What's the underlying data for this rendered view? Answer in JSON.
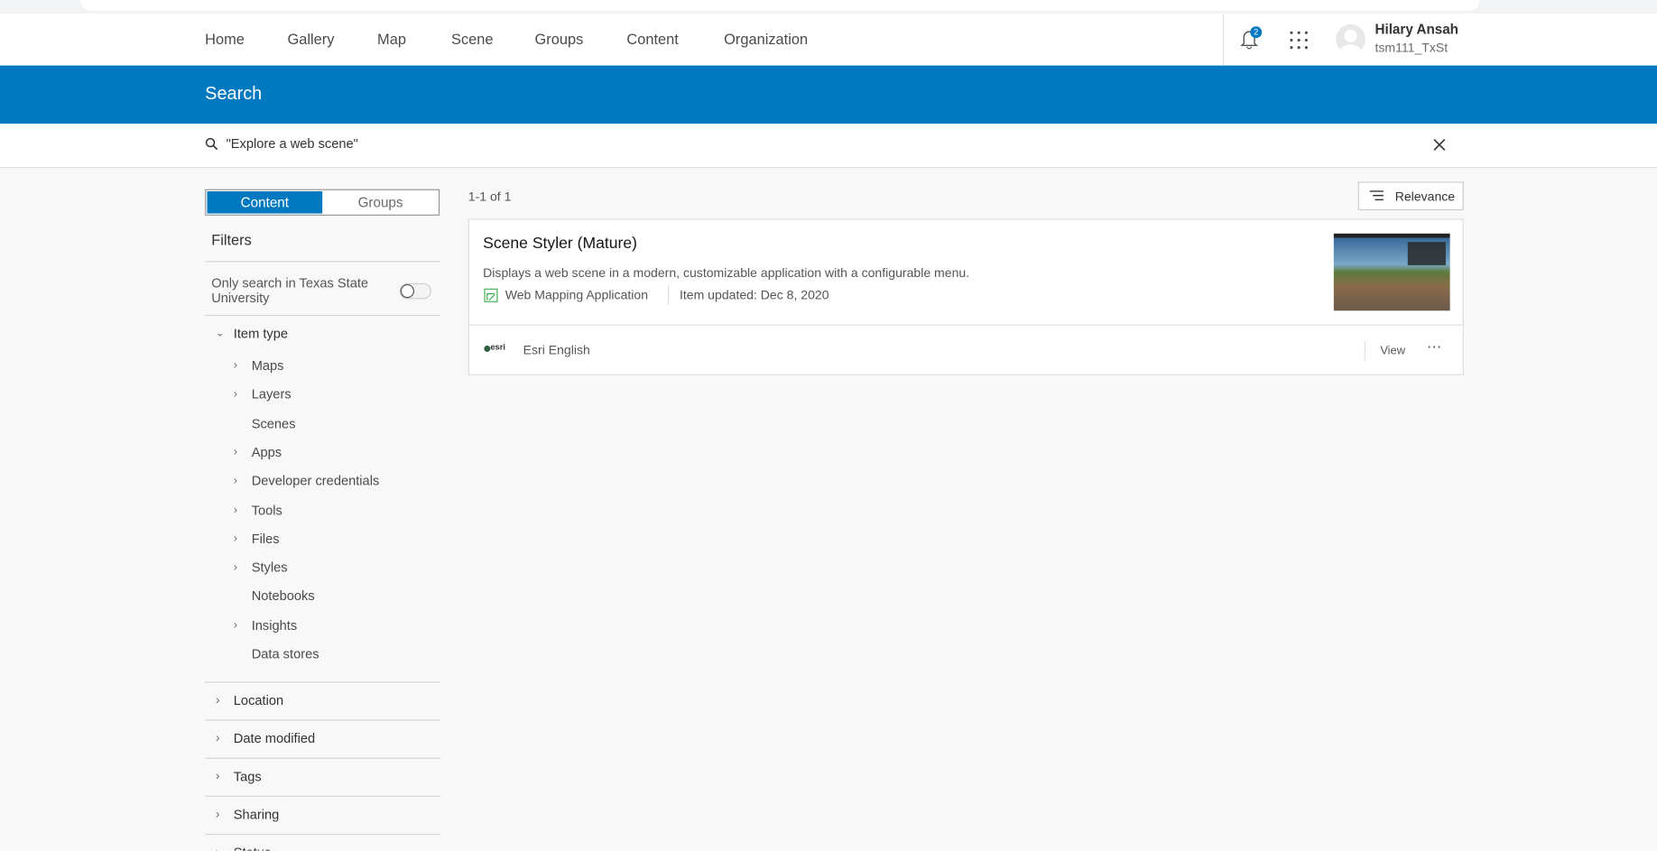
{
  "nav": {
    "items": [
      "Home",
      "Gallery",
      "Map",
      "Scene",
      "Groups",
      "Content",
      "Organization"
    ],
    "notification_count": "2",
    "user_name": "Hilary Ansah",
    "user_id": "tsm111_TxSt"
  },
  "banner": {
    "title": "Search"
  },
  "search": {
    "query": "\"Explore a web scene\""
  },
  "sidebar": {
    "tabs": [
      "Content",
      "Groups"
    ],
    "filters_title": "Filters",
    "toggle_label": "Only search in Texas State University",
    "toggle_on": false,
    "item_type": {
      "label": "Item type",
      "items": [
        {
          "label": "Maps",
          "expandable": true
        },
        {
          "label": "Layers",
          "expandable": true
        },
        {
          "label": "Scenes",
          "expandable": false
        },
        {
          "label": "Apps",
          "expandable": true
        },
        {
          "label": "Developer credentials",
          "expandable": true
        },
        {
          "label": "Tools",
          "expandable": true
        },
        {
          "label": "Files",
          "expandable": true
        },
        {
          "label": "Styles",
          "expandable": true
        },
        {
          "label": "Notebooks",
          "expandable": false
        },
        {
          "label": "Insights",
          "expandable": true
        },
        {
          "label": "Data stores",
          "expandable": false
        }
      ]
    },
    "sections": [
      "Location",
      "Date modified",
      "Tags",
      "Sharing",
      "Status"
    ]
  },
  "results": {
    "count": "1-1 of 1",
    "sort_label": "Relevance",
    "items": [
      {
        "title": "Scene Styler (Mature)",
        "description": "Displays a web scene in a modern, customizable application with a configurable menu.",
        "type": "Web Mapping Application",
        "updated": "Item updated: Dec 8, 2020",
        "owner": "Esri English",
        "view_label": "View"
      }
    ]
  },
  "colors": {
    "brand": "#0079c1",
    "app_icon": "#35ac46"
  }
}
